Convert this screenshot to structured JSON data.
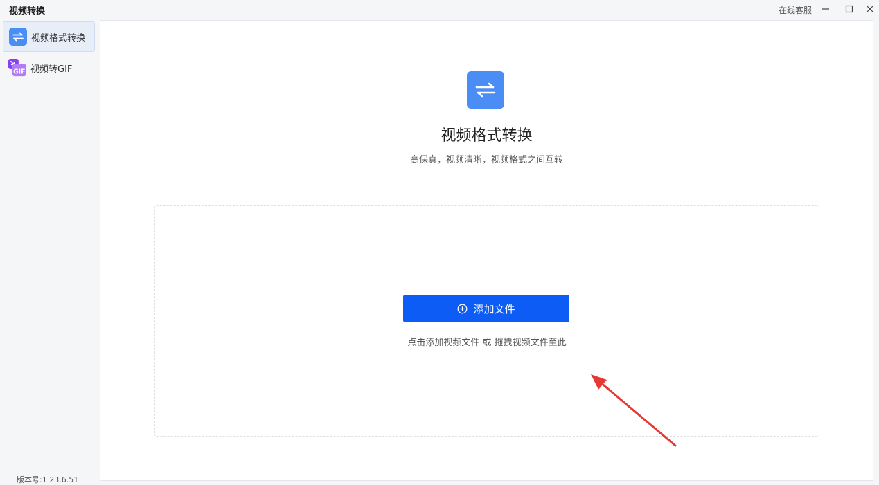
{
  "window": {
    "title": "视频转换",
    "service_label": "在线客服",
    "minimize_icon": "minimize-icon",
    "maximize_icon": "maximize-icon",
    "close_icon": "close-icon"
  },
  "sidebar": {
    "items": [
      {
        "label": "视频格式转换",
        "icon": "swap-arrows-icon",
        "active": true
      },
      {
        "label": "视频转GIF",
        "icon": "gif-icon",
        "icon_text": "GIF",
        "active": false
      }
    ],
    "version": "版本号:1.23.6.51"
  },
  "main": {
    "icon": "swap-arrows-icon",
    "title": "视频格式转换",
    "subtitle": "高保真，视频清晰，视频格式之间互转",
    "add_button": {
      "label": "添加文件",
      "icon": "plus-circle-icon"
    },
    "drop_hint": "点击添加视频文件 或 拖拽视频文件至此"
  },
  "colors": {
    "accent": "#0d5cf5",
    "icon_blue": "#4a8ef5",
    "annotation_arrow": "#e53935"
  }
}
